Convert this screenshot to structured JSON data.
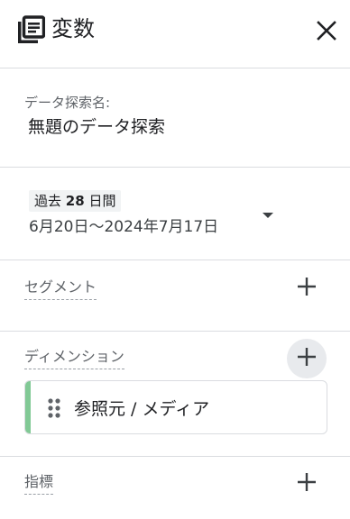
{
  "header": {
    "title": "変数",
    "icon": "explore-list-icon",
    "close_icon": "close-icon"
  },
  "exploration": {
    "name_label": "データ探索名:",
    "name_value": "無題のデータ探索"
  },
  "date": {
    "chip_prefix": "過去",
    "chip_number": "28",
    "chip_suffix": "日間",
    "range": "6月20日～2024年7月17日"
  },
  "segments": {
    "label": "セグメント"
  },
  "dimensions": {
    "label": "ディメンション",
    "items": [
      {
        "label": "参照元 / メディア",
        "accent": "#81c995"
      }
    ]
  },
  "metrics": {
    "label": "指標"
  },
  "colors": {
    "divider": "#dadce0",
    "text": "#202124",
    "muted": "#5f6368",
    "accent_green": "#81c995"
  }
}
